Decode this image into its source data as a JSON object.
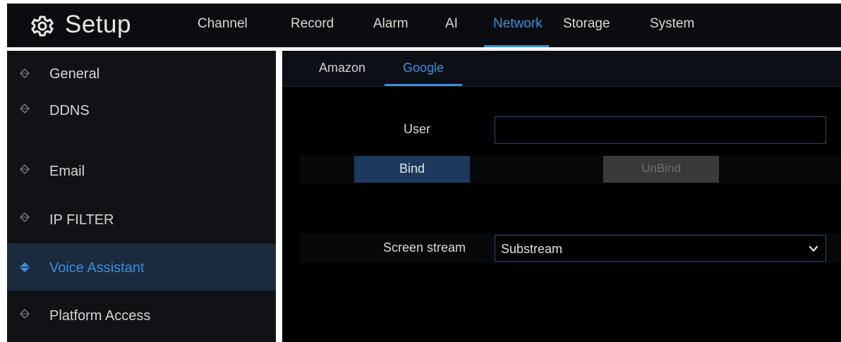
{
  "header": {
    "title": "Setup",
    "gear_icon": "gear-icon",
    "nav": [
      {
        "label": "Channel",
        "active": false
      },
      {
        "label": "Record",
        "active": false
      },
      {
        "label": "Alarm",
        "active": false
      },
      {
        "label": "AI",
        "active": false
      },
      {
        "label": "Network",
        "active": true
      },
      {
        "label": "Storage",
        "active": false
      },
      {
        "label": "System",
        "active": false
      }
    ]
  },
  "sidebar": {
    "items": [
      {
        "label": "General",
        "icon": "diamond-bullet-icon",
        "active": false
      },
      {
        "label": "DDNS",
        "icon": "diamond-bullet-icon",
        "active": false
      },
      {
        "label": "Email",
        "icon": "diamond-bullet-icon",
        "active": false
      },
      {
        "label": "IP FILTER",
        "icon": "diamond-bullet-icon",
        "active": false
      },
      {
        "label": "Voice Assistant",
        "icon": "diamond-bullet-icon",
        "active": true
      },
      {
        "label": "Platform Access",
        "icon": "diamond-bullet-icon",
        "active": false
      }
    ]
  },
  "subtabs": [
    {
      "label": "Amazon",
      "active": false
    },
    {
      "label": "Google",
      "active": true
    }
  ],
  "form": {
    "user_label": "User",
    "user_value": "",
    "bind_label": "Bind",
    "unbind_label": "UnBind",
    "screen_stream_label": "Screen stream",
    "screen_stream_value": "Substream",
    "dropdown_icon": "chevron-down-icon"
  },
  "colors": {
    "accent": "#3b8fe0",
    "background": "#000000",
    "sidebar_bg": "#101216",
    "active_item_bg": "#1b2a3d"
  }
}
